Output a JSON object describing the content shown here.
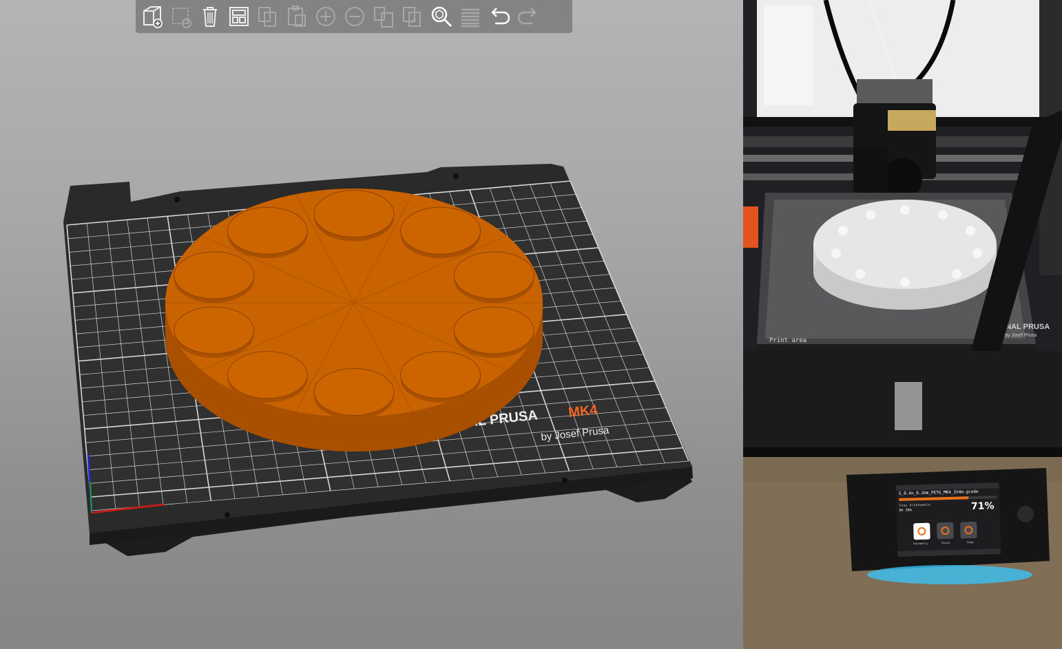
{
  "slicer": {
    "toolbar": {
      "buttons": [
        {
          "icon": "add-object-icon",
          "enabled": true
        },
        {
          "icon": "delete-object-icon",
          "enabled": false
        },
        {
          "icon": "delete-all-icon",
          "enabled": true
        },
        {
          "icon": "arrange-icon",
          "enabled": true
        },
        {
          "icon": "copy-icon",
          "enabled": false
        },
        {
          "icon": "paste-icon",
          "enabled": false
        },
        {
          "icon": "add-instance-icon",
          "enabled": false
        },
        {
          "icon": "remove-instance-icon",
          "enabled": false
        },
        {
          "icon": "split-objects-icon",
          "enabled": false
        },
        {
          "icon": "split-parts-icon",
          "enabled": false
        },
        {
          "icon": "search-icon",
          "enabled": true
        },
        {
          "icon": "layers-editing-icon",
          "enabled": false
        },
        {
          "icon": "undo-icon",
          "enabled": true
        },
        {
          "icon": "redo-icon",
          "enabled": false
        }
      ]
    },
    "bed": {
      "logo_text": "INAL PRUSA",
      "logo_model": "MK4",
      "logo_byline": "by Josef Prusa"
    },
    "colors": {
      "model": "#c96200",
      "model_side": "#a95000",
      "bed_sheet": "#2e2e2e",
      "grid_line": "#e6e6e6",
      "brand_orange": "#f26522"
    }
  },
  "photo": {
    "bed_print_text": "Print area",
    "sheet_brand": "ORIGINAL PRUSA",
    "sheet_byline": "by Josef Prusa",
    "display": {
      "filename": "S_0.4n_0.2mm_PETG_MK4_1h4m.gcode",
      "progress_percent": 71,
      "progress_label": "71%",
      "time_label": "Czas drukowania",
      "time_value": "0h 30m",
      "buttons": [
        "Parametry",
        "Pauza",
        "Stop"
      ]
    }
  }
}
